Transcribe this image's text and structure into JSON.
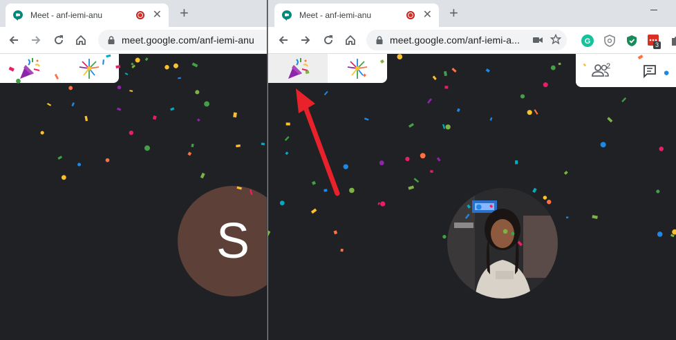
{
  "left_window": {
    "tab_title": "Meet - anf-iemi-anu",
    "url": "meet.google.com/anf-iemi-anu",
    "avatar_initial": "S"
  },
  "right_window": {
    "tab_title": "Meet - anf-iemi-anu",
    "url": "meet.google.com/anf-iemi-a...",
    "participant_count": "2",
    "extension_badge": "3"
  },
  "colors": {
    "background": "#202124",
    "avatar": "#5d4037",
    "arrow": "#e8212b",
    "confetti": [
      "#e91e63",
      "#1e88e5",
      "#43a047",
      "#fbc02d",
      "#8e24aa",
      "#ff7043",
      "#00acc1",
      "#7cb342"
    ]
  },
  "icons": {
    "reaction_1": "party-popper-icon",
    "reaction_2": "fireworks-icon",
    "people": "people-icon",
    "chat": "chat-icon"
  }
}
